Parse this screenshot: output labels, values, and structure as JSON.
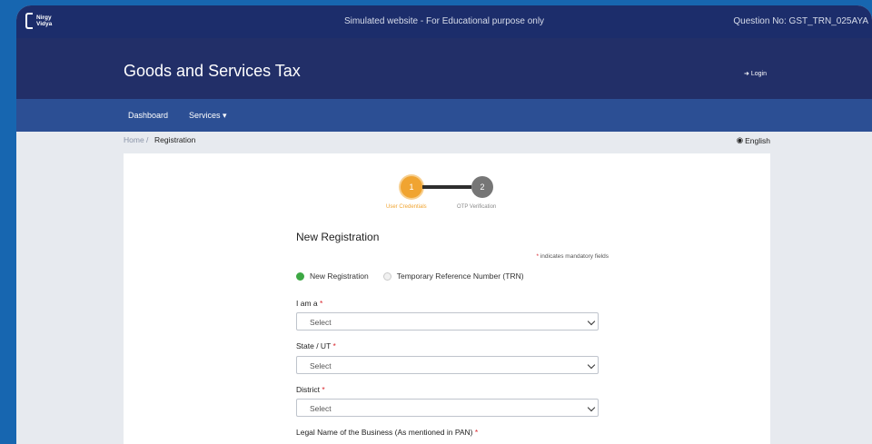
{
  "topbar": {
    "logo_line1": "Nirgy",
    "logo_line2": "Vidya",
    "simulated_text": "Simulated website - For Educational purpose only",
    "question_no": "Question No: GST_TRN_025AYA"
  },
  "header": {
    "title": "Goods and Services Tax",
    "login_label": "Login"
  },
  "nav": {
    "dashboard": "Dashboard",
    "services": "Services ▾"
  },
  "breadcrumb": {
    "home": "Home",
    "separator": "/",
    "current": "Registration",
    "language": "English"
  },
  "stepper": {
    "step1_number": "1",
    "step1_label": "User Credentials",
    "step2_number": "2",
    "step2_label": "OTP Verification"
  },
  "form": {
    "title": "New Registration",
    "mandatory_star": "*",
    "mandatory_note": "indicates mandatory fields",
    "radio_new": "New Registration",
    "radio_trn": "Temporary Reference Number (TRN)",
    "i_am_a_label": "I am a",
    "state_label": "State / UT",
    "district_label": "District",
    "legal_name_label": "Legal Name of the Business (As mentioned in PAN)",
    "required_star": "*",
    "select_placeholder": "Select"
  },
  "colors": {
    "topbar": "#1c2d6b",
    "header": "#222f68",
    "nav": "#2c4f94",
    "accent_orange": "#f0a431",
    "radio_green": "#3da844",
    "required_red": "#d9262d",
    "outer_bg": "#1766b0"
  }
}
